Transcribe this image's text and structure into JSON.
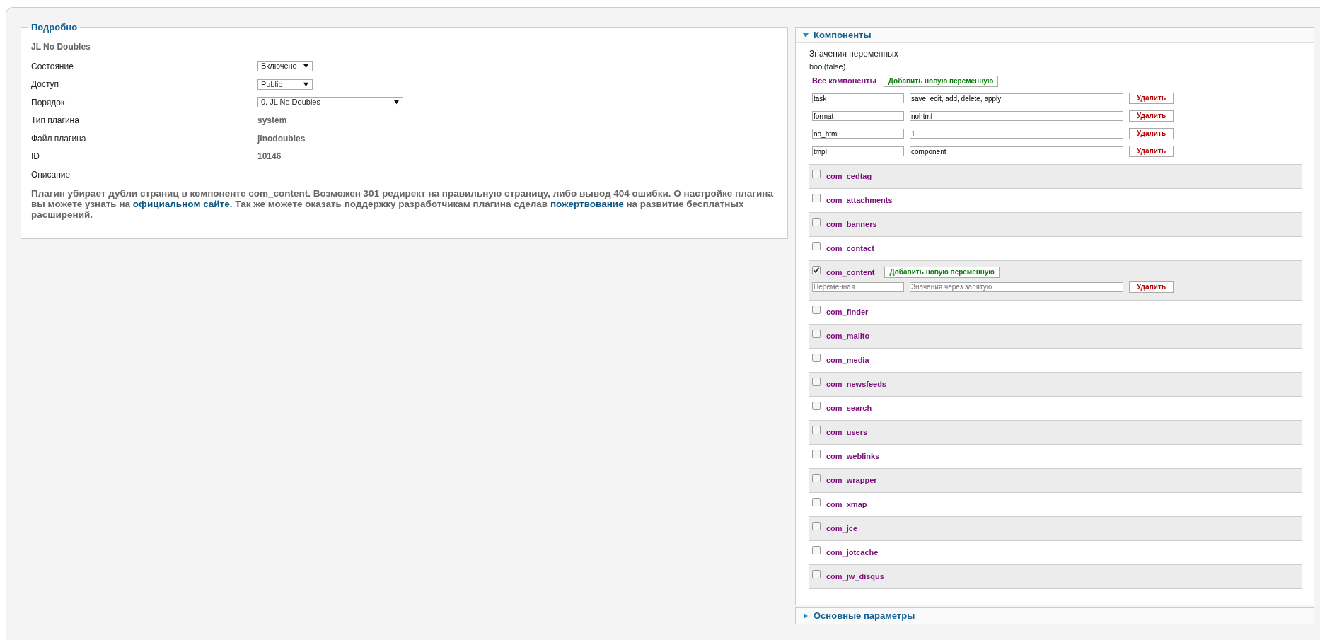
{
  "details": {
    "legend": "Подробно",
    "plugin_title": "JL No Doubles",
    "fields": [
      {
        "label": "Состояние",
        "kind": "select",
        "value": "Включено"
      },
      {
        "label": "Доступ",
        "kind": "select",
        "value": "Public"
      },
      {
        "label": "Порядок",
        "kind": "wideselect",
        "value": "0. JL No Doubles"
      },
      {
        "label": "Тип плагина",
        "kind": "text",
        "value": "system"
      },
      {
        "label": "Файл плагина",
        "kind": "text",
        "value": "jlnodoubles"
      },
      {
        "label": "ID",
        "kind": "text",
        "value": "10146"
      },
      {
        "label": "Описание",
        "kind": "none"
      }
    ],
    "description": [
      {
        "kind": "text",
        "text": "Плагин убирает дубли страниц в компоненте com_content. Возможен 301 редирект на правильную страницу, либо вывод 404 ошибки. О настройке плагина вы можете узнать на "
      },
      {
        "kind": "link",
        "text": "официальном сайте"
      },
      {
        "kind": "text",
        "text": ". Так же можете оказать поддержку разработчикам плагина сделав "
      },
      {
        "kind": "link",
        "text": "пожертвование"
      },
      {
        "kind": "text",
        "text": " на развитие бесплатных расширений."
      }
    ]
  },
  "panels": [
    {
      "title": "Компоненты",
      "expanded": true,
      "body": {
        "heading": "Значения переменных",
        "debug": "bool(false)",
        "all_label": "Все компоненты",
        "add_label": "Добавить новую переменную",
        "variables": [
          {
            "name": "task",
            "values": "save, edit, add, delete, apply",
            "delete_label": "Удалить"
          },
          {
            "name": "format",
            "values": "nohtml",
            "delete_label": "Удалить"
          },
          {
            "name": "no_html",
            "values": "1",
            "delete_label": "Удалить"
          },
          {
            "name": "tmpl",
            "values": "component",
            "delete_label": "Удалить"
          }
        ],
        "components": [
          {
            "name": "com_cedtag",
            "checked": false
          },
          {
            "name": "com_attachments",
            "checked": false
          },
          {
            "name": "com_banners",
            "checked": false
          },
          {
            "name": "com_contact",
            "checked": false
          },
          {
            "name": "com_content",
            "checked": true,
            "add_label": "Добавить новую переменную",
            "variables": [
              {
                "name_placeholder": "Переменная",
                "values_placeholder": "Значения через запятую",
                "delete_label": "Удалить"
              }
            ]
          },
          {
            "name": "com_finder",
            "checked": false
          },
          {
            "name": "com_mailto",
            "checked": false
          },
          {
            "name": "com_media",
            "checked": false
          },
          {
            "name": "com_newsfeeds",
            "checked": false
          },
          {
            "name": "com_search",
            "checked": false
          },
          {
            "name": "com_users",
            "checked": false
          },
          {
            "name": "com_weblinks",
            "checked": false
          },
          {
            "name": "com_wrapper",
            "checked": false
          },
          {
            "name": "com_xmap",
            "checked": false
          },
          {
            "name": "com_jce",
            "checked": false
          },
          {
            "name": "com_jotcache",
            "checked": false
          },
          {
            "name": "com_jw_disqus",
            "checked": false
          }
        ]
      }
    },
    {
      "title": "Основные параметры",
      "expanded": false
    }
  ]
}
